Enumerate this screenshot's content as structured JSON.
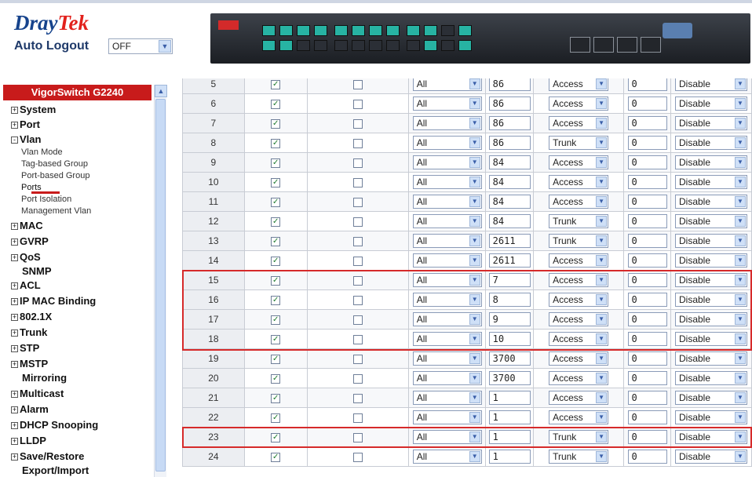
{
  "header": {
    "logo": {
      "brand": "Dray",
      "brand_accent": "Tek"
    },
    "auto_logout_label": "Auto Logout",
    "auto_logout_value": "OFF"
  },
  "sidebar": {
    "title": "VigorSwitch G2240",
    "items": [
      {
        "label": "System",
        "expander": "+"
      },
      {
        "label": "Port",
        "expander": "+"
      },
      {
        "label": "Vlan",
        "expander": "-"
      },
      {
        "label": "MAC",
        "expander": "+"
      },
      {
        "label": "GVRP",
        "expander": "+"
      },
      {
        "label": "QoS",
        "expander": "+"
      },
      {
        "label": "SNMP",
        "expander": ""
      },
      {
        "label": "ACL",
        "expander": "+"
      },
      {
        "label": "IP MAC Binding",
        "expander": "+"
      },
      {
        "label": "802.1X",
        "expander": "+"
      },
      {
        "label": "Trunk",
        "expander": "+"
      },
      {
        "label": "STP",
        "expander": "+"
      },
      {
        "label": "MSTP",
        "expander": "+"
      },
      {
        "label": "Mirroring",
        "expander": ""
      },
      {
        "label": "Multicast",
        "expander": "+"
      },
      {
        "label": "Alarm",
        "expander": "+"
      },
      {
        "label": "DHCP Snooping",
        "expander": "+"
      },
      {
        "label": "LLDP",
        "expander": "+"
      },
      {
        "label": "Save/Restore",
        "expander": "+"
      },
      {
        "label": "Export/Import",
        "expander": ""
      }
    ],
    "vlan_subitems": [
      "Vlan Mode",
      "Tag-based Group",
      "Port-based Group",
      "Ports",
      "Port Isolation",
      "Management Vlan"
    ]
  },
  "ports_table": {
    "rows": [
      {
        "port": "5",
        "checked": true,
        "checked2": false,
        "frame": "All",
        "pvid": "86",
        "mode": "Access",
        "priority": "0",
        "state": "Disable"
      },
      {
        "port": "6",
        "checked": true,
        "checked2": false,
        "frame": "All",
        "pvid": "86",
        "mode": "Access",
        "priority": "0",
        "state": "Disable"
      },
      {
        "port": "7",
        "checked": true,
        "checked2": false,
        "frame": "All",
        "pvid": "86",
        "mode": "Access",
        "priority": "0",
        "state": "Disable"
      },
      {
        "port": "8",
        "checked": true,
        "checked2": false,
        "frame": "All",
        "pvid": "86",
        "mode": "Trunk",
        "priority": "0",
        "state": "Disable"
      },
      {
        "port": "9",
        "checked": true,
        "checked2": false,
        "frame": "All",
        "pvid": "84",
        "mode": "Access",
        "priority": "0",
        "state": "Disable"
      },
      {
        "port": "10",
        "checked": true,
        "checked2": false,
        "frame": "All",
        "pvid": "84",
        "mode": "Access",
        "priority": "0",
        "state": "Disable"
      },
      {
        "port": "11",
        "checked": true,
        "checked2": false,
        "frame": "All",
        "pvid": "84",
        "mode": "Access",
        "priority": "0",
        "state": "Disable"
      },
      {
        "port": "12",
        "checked": true,
        "checked2": false,
        "frame": "All",
        "pvid": "84",
        "mode": "Trunk",
        "priority": "0",
        "state": "Disable"
      },
      {
        "port": "13",
        "checked": true,
        "checked2": false,
        "frame": "All",
        "pvid": "2611",
        "mode": "Trunk",
        "priority": "0",
        "state": "Disable"
      },
      {
        "port": "14",
        "checked": true,
        "checked2": false,
        "frame": "All",
        "pvid": "2611",
        "mode": "Access",
        "priority": "0",
        "state": "Disable"
      },
      {
        "port": "15",
        "checked": true,
        "checked2": false,
        "frame": "All",
        "pvid": "7",
        "mode": "Access",
        "priority": "0",
        "state": "Disable"
      },
      {
        "port": "16",
        "checked": true,
        "checked2": false,
        "frame": "All",
        "pvid": "8",
        "mode": "Access",
        "priority": "0",
        "state": "Disable"
      },
      {
        "port": "17",
        "checked": true,
        "checked2": false,
        "frame": "All",
        "pvid": "9",
        "mode": "Access",
        "priority": "0",
        "state": "Disable"
      },
      {
        "port": "18",
        "checked": true,
        "checked2": false,
        "frame": "All",
        "pvid": "10",
        "mode": "Access",
        "priority": "0",
        "state": "Disable"
      },
      {
        "port": "19",
        "checked": true,
        "checked2": false,
        "frame": "All",
        "pvid": "3700",
        "mode": "Access",
        "priority": "0",
        "state": "Disable"
      },
      {
        "port": "20",
        "checked": true,
        "checked2": false,
        "frame": "All",
        "pvid": "3700",
        "mode": "Access",
        "priority": "0",
        "state": "Disable"
      },
      {
        "port": "21",
        "checked": true,
        "checked2": false,
        "frame": "All",
        "pvid": "1",
        "mode": "Access",
        "priority": "0",
        "state": "Disable"
      },
      {
        "port": "22",
        "checked": true,
        "checked2": false,
        "frame": "All",
        "pvid": "1",
        "mode": "Access",
        "priority": "0",
        "state": "Disable"
      },
      {
        "port": "23",
        "checked": true,
        "checked2": false,
        "frame": "All",
        "pvid": "1",
        "mode": "Trunk",
        "priority": "0",
        "state": "Disable"
      },
      {
        "port": "24",
        "checked": true,
        "checked2": false,
        "frame": "All",
        "pvid": "1",
        "mode": "Trunk",
        "priority": "0",
        "state": "Disable"
      }
    ]
  },
  "colors": {
    "brand_blue": "#16438c",
    "brand_red": "#e2211c",
    "sidebar_title_bg": "#c81b1b",
    "highlight": "#d62a2a"
  }
}
